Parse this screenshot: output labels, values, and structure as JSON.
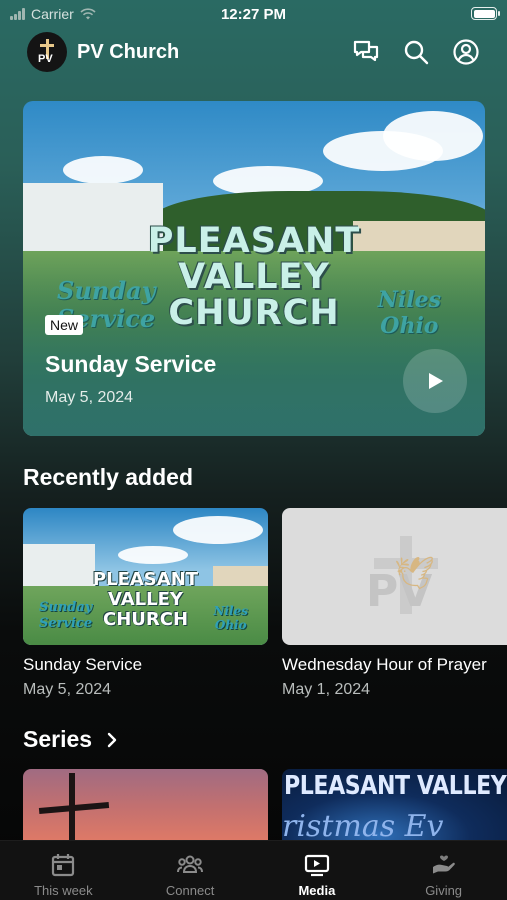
{
  "status_bar": {
    "carrier": "Carrier",
    "time": "12:27 PM"
  },
  "header": {
    "logo_text": "PV",
    "title": "PV Church",
    "icons": [
      "chat-icon",
      "search-icon",
      "profile-icon"
    ]
  },
  "hero": {
    "artwork": {
      "title_lines": [
        "PLEASANT",
        "VALLEY",
        "CHURCH"
      ],
      "left_script": [
        "Sunday",
        "Service"
      ],
      "right_script": [
        "Niles",
        "Ohio"
      ]
    },
    "badge": "New",
    "title": "Sunday Service",
    "date": "May 5, 2024"
  },
  "recently_added": {
    "heading": "Recently added",
    "items": [
      {
        "title": "Sunday Service",
        "date": "May 5, 2024",
        "artwork": {
          "title_lines": [
            "PLEASANT",
            "VALLEY",
            "CHURCH"
          ],
          "left_script": [
            "Sunday",
            "Service"
          ],
          "right_script": [
            "Niles",
            "Ohio"
          ]
        }
      },
      {
        "title": "Wednesday Hour of Prayer",
        "date": "May 1, 2024",
        "artwork": {
          "logo_text": "PV"
        }
      }
    ]
  },
  "series": {
    "heading": "Series",
    "items": [
      {
        "artwork_text": ""
      },
      {
        "artwork_text": "PLEASANT VALLEY CHU",
        "artwork_sub": "ristmas Ev"
      }
    ]
  },
  "tabbar": {
    "tabs": [
      {
        "label": "This week",
        "icon": "calendar-icon",
        "active": false
      },
      {
        "label": "Connect",
        "icon": "people-icon",
        "active": false
      },
      {
        "label": "Media",
        "icon": "tv-play-icon",
        "active": true
      },
      {
        "label": "Giving",
        "icon": "hand-giving-icon",
        "active": false
      }
    ]
  },
  "colors": {
    "accent": "#2a6a63",
    "background": "#050505",
    "tab_inactive": "#8b8b8b"
  }
}
